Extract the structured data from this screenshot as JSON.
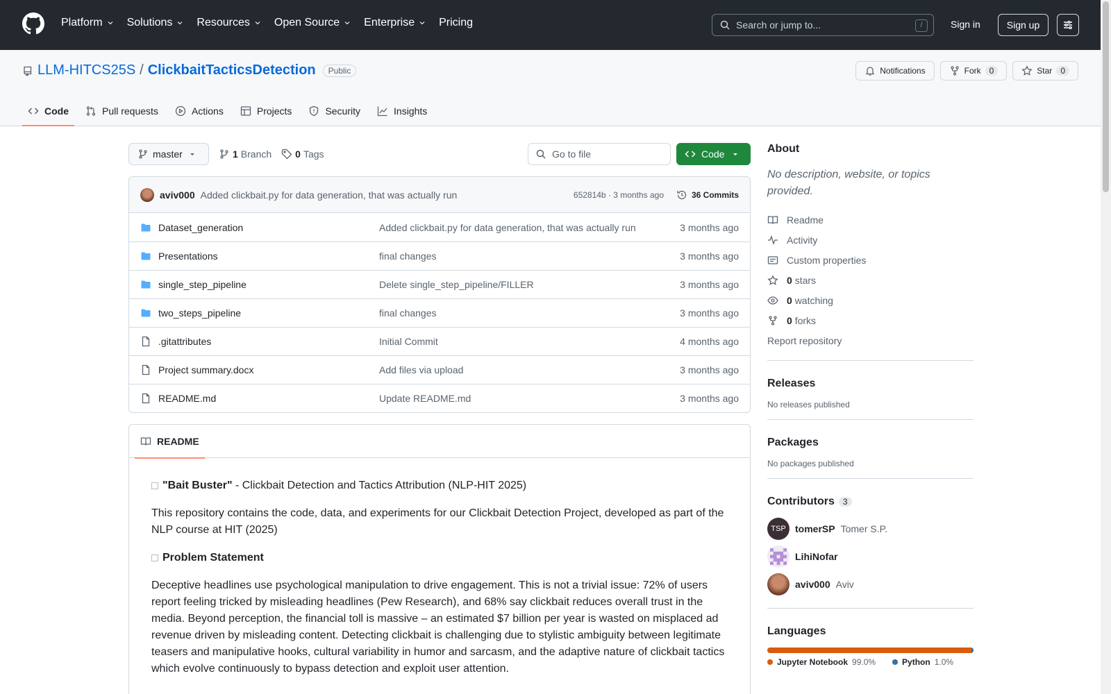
{
  "nav": {
    "items": [
      "Platform",
      "Solutions",
      "Resources",
      "Open Source",
      "Enterprise"
    ],
    "pricing": "Pricing",
    "search_placeholder": "Search or jump to...",
    "slash": "/",
    "sign_in": "Sign in",
    "sign_up": "Sign up"
  },
  "repo": {
    "owner": "LLM-HITCS25S",
    "sep": "/",
    "name": "ClickbaitTacticsDetection",
    "visibility": "Public",
    "notifications": "Notifications",
    "fork_label": "Fork",
    "fork_count": "0",
    "star_label": "Star",
    "star_count": "0"
  },
  "tabs": [
    "Code",
    "Pull requests",
    "Actions",
    "Projects",
    "Security",
    "Insights"
  ],
  "toolbar": {
    "branch": "master",
    "branch_count": "1",
    "branch_label": "Branch",
    "tag_count": "0",
    "tag_label": "Tags",
    "goto_placeholder": "Go to file",
    "code_label": "Code"
  },
  "commit": {
    "author": "aviv000",
    "message": "Added clickbait.py for data generation, that was actually run",
    "meta": "652814b · 3 months ago",
    "count": "36 Commits"
  },
  "files": [
    {
      "type": "dir",
      "name": "Dataset_generation",
      "message": "Added clickbait.py for data generation, that was actually run",
      "date": "3 months ago"
    },
    {
      "type": "dir",
      "name": "Presentations",
      "message": "final changes",
      "date": "3 months ago"
    },
    {
      "type": "dir",
      "name": "single_step_pipeline",
      "message": "Delete single_step_pipeline/FILLER",
      "date": "3 months ago"
    },
    {
      "type": "dir",
      "name": "two_steps_pipeline",
      "message": "final changes",
      "date": "3 months ago"
    },
    {
      "type": "file",
      "name": ".gitattributes",
      "message": "Initial Commit",
      "date": "4 months ago"
    },
    {
      "type": "file",
      "name": "Project summary.docx",
      "message": "Add files via upload",
      "date": "3 months ago"
    },
    {
      "type": "file",
      "name": "README.md",
      "message": "Update README.md",
      "date": "3 months ago"
    }
  ],
  "readme": {
    "tab": "README",
    "title_bold": "\"Bait Buster\"",
    "title_rest": " - Clickbait Detection and Tactics Attribution (NLP-HIT 2025)",
    "intro": "This repository contains the code, data, and experiments for our Clickbait Detection Project, developed as part of the NLP course at HIT (2025)",
    "heading": "Problem Statement",
    "body": "Deceptive headlines use psychological manipulation to drive engagement. This is not a trivial issue: 72% of users report feeling tricked by misleading headlines (Pew Research), and 68% say clickbait reduces overall trust in the media. Beyond perception, the financial toll is massive – an estimated $7 billion per year is wasted on misplaced ad revenue driven by misleading content. Detecting clickbait is challenging due to stylistic ambiguity between legitimate teasers and manipulative hooks, cultural variability in humor and sarcasm, and the adaptive nature of clickbait tactics which evolve continuously to bypass detection and exploit user attention."
  },
  "sidebar": {
    "about_title": "About",
    "about_desc": "No description, website, or topics provided.",
    "links": [
      {
        "icon": "book-icon",
        "label": "Readme"
      },
      {
        "icon": "pulse-icon",
        "label": "Activity"
      },
      {
        "icon": "note-icon",
        "label": "Custom properties"
      }
    ],
    "stars_count": "0",
    "stars_label": "stars",
    "watching_count": "0",
    "watching_label": "watching",
    "forks_count": "0",
    "forks_label": "forks",
    "report": "Report repository",
    "releases_title": "Releases",
    "releases_text": "No releases published",
    "packages_title": "Packages",
    "packages_text": "No packages published",
    "contributors_title": "Contributors",
    "contributors_count": "3",
    "contributors": [
      {
        "initials": "TSP",
        "login": "tomerSP",
        "name": "Tomer S.P."
      },
      {
        "initials": "",
        "login": "LihiNofar",
        "name": ""
      },
      {
        "initials": "",
        "login": "aviv000",
        "name": "Aviv"
      }
    ],
    "languages_title": "Languages",
    "languages": [
      {
        "name": "Jupyter Notebook",
        "percent": "99.0%",
        "value": 99.0,
        "color": "#DA5B0B"
      },
      {
        "name": "Python",
        "percent": "1.0%",
        "value": 1.0,
        "color": "#3572A5"
      }
    ]
  }
}
